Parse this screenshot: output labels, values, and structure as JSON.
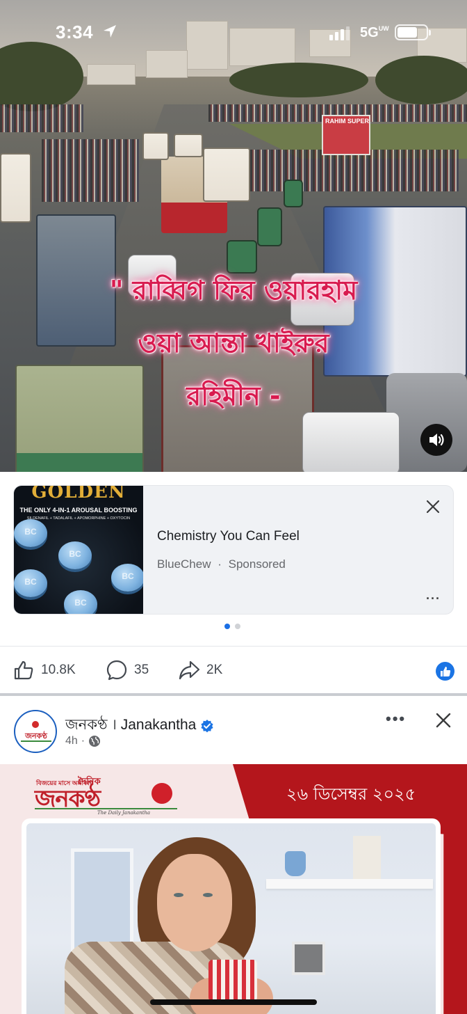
{
  "status_bar": {
    "time": "3:34",
    "network": "5G",
    "network_suffix": "UW"
  },
  "video": {
    "caption_lines": [
      "\" রাব্বিগ ফির ওয়ারহাম",
      "ওয়া আন্তা খাইরুর",
      "রহিমীন -"
    ],
    "sign_text": "RAHIM SUPER"
  },
  "ad": {
    "image_headline": "GOLDEN",
    "image_subline": "THE ONLY 4-IN-1 AROUSAL BOOSTING",
    "image_ingredients": "SILDENAFIL + TADALAFIL + APOMORPHINE + OXYTOCIN",
    "pill_mark": "BC",
    "title": "Chemistry You Can Feel",
    "advertiser": "BlueChew",
    "sponsored_label": "Sponsored",
    "separator": "·",
    "more_label": "···"
  },
  "carousel": {
    "count": 2,
    "active": 0
  },
  "actions": {
    "likes": "10.8K",
    "comments": "35",
    "shares": "2K"
  },
  "next_post": {
    "page_name": "জনকণ্ঠ । Janakantha",
    "time_ago": "4h",
    "dot": "·",
    "more_label": "•••",
    "avatar_text": "জনকণ্ঠ",
    "banner_tagline": "বিজয়ের মাসে অঙ্গীকার",
    "banner_daily": "দৈনিক",
    "banner_brand": "জনকণ্ঠ",
    "banner_english": "The Daily Janakantha",
    "banner_date": "২৬ ডিসেম্বর ২০২৫"
  },
  "colors": {
    "facebook_blue": "#1b74e4",
    "caption_pink": "#d81b4f",
    "janakantha_red": "#b4161c"
  }
}
